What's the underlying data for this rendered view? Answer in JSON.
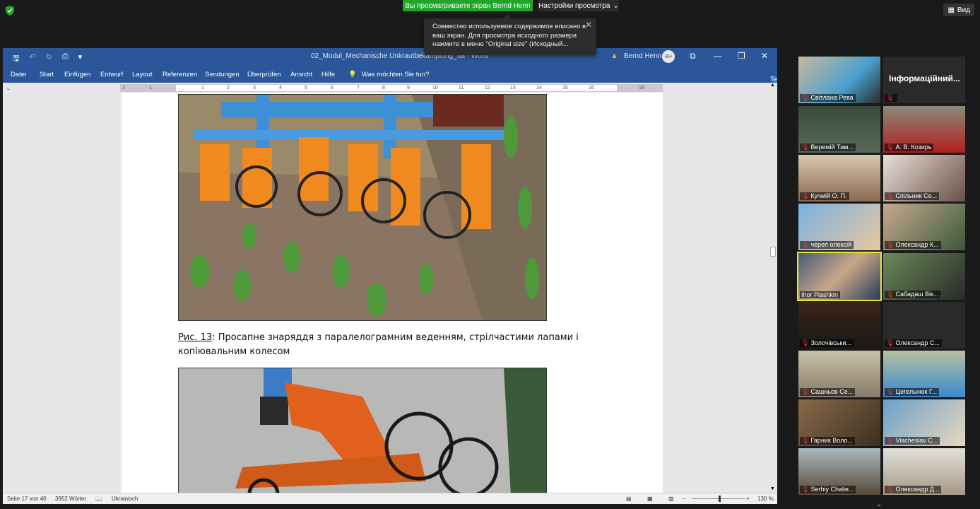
{
  "zoom": {
    "view_banner": "Вы просматриваете экран Bernd Henn",
    "view_settings": "Настройки просмотра",
    "view_button": "Вид",
    "tooltip": "Совместно используемое содержимое вписано в ваш экран. Для просмотра исходного размера нажмите в меню \"Original size\" (Исходный...",
    "participants": [
      {
        "name": "Світлана Рева"
      },
      {
        "name": "Інформаційний...",
        "video": false
      },
      {
        "name": "Веремій Там..."
      },
      {
        "name": "А. В. Козирь"
      },
      {
        "name": "Кучмій О. П."
      },
      {
        "name": "Спільник Се..."
      },
      {
        "name": "череп олексій"
      },
      {
        "name": "Олександр К..."
      },
      {
        "name": "Ihor Plashkin",
        "active": true
      },
      {
        "name": "Сабадаш Вік..."
      },
      {
        "name": "Золочівськи..."
      },
      {
        "name": "Олександр С..."
      },
      {
        "name": "Сашньов Се..."
      },
      {
        "name": "Цегельнюк Г..."
      },
      {
        "name": "Гарник Воло..."
      },
      {
        "name": "Viacheslav С..."
      },
      {
        "name": "Serhiy Chalie..."
      },
      {
        "name": "Олександр Д..."
      }
    ]
  },
  "word": {
    "doc_title": "02_Modul_Mechanische Unkrautbekämpfung_ua - Word",
    "user_name": "Bernd Henn",
    "user_initials": "BH",
    "tabs": [
      "Datei",
      "Start",
      "Einfügen",
      "Entwurf",
      "Layout",
      "Referenzen",
      "Sendungen",
      "Überprüfen",
      "Ansicht",
      "Hilfe"
    ],
    "tell_me": "Was möchten Sie tun?",
    "share": "Teilen",
    "ruler_numbers": [
      "2",
      "1",
      "1",
      "2",
      "3",
      "4",
      "5",
      "6",
      "7",
      "8",
      "9",
      "10",
      "11",
      "12",
      "13",
      "14",
      "15",
      "16",
      "18"
    ],
    "caption_fig": "Рис. 13",
    "caption_text": ": Просапне знаряддя з паралелограмним веденням, стрілчастими лапами і копіювальним колесом",
    "status": {
      "page": "Seite 17 von 40",
      "words": "3952 Wörter",
      "language": "Ukrainisch",
      "zoom": "130 %"
    }
  }
}
